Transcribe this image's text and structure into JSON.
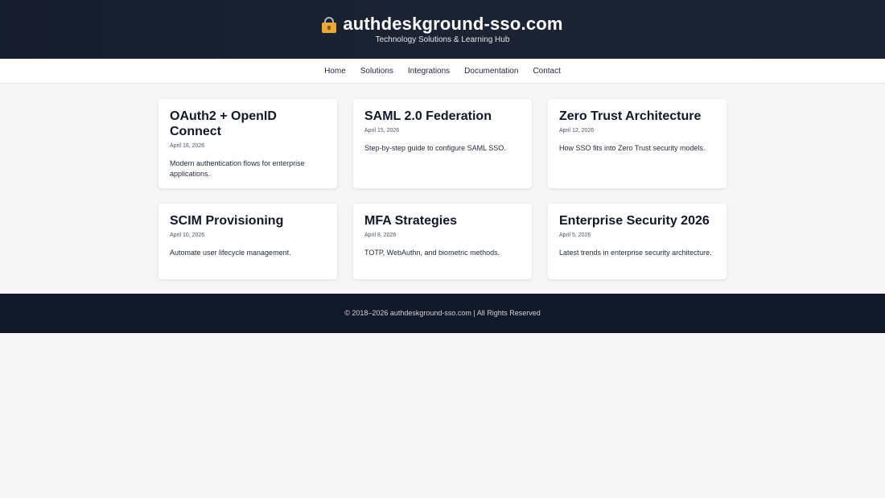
{
  "header": {
    "logo_icon": "lock-icon",
    "site_title": "authdeskground-sso.com",
    "tagline": "Technology Solutions & Learning Hub"
  },
  "nav": {
    "items": [
      {
        "label": "Home"
      },
      {
        "label": "Solutions"
      },
      {
        "label": "Integrations"
      },
      {
        "label": "Documentation"
      },
      {
        "label": "Contact"
      }
    ]
  },
  "cards": [
    {
      "title": "OAuth2 + OpenID Connect",
      "date": "April 18, 2026",
      "desc": "Modern authentication flows for enterprise applications."
    },
    {
      "title": "SAML 2.0 Federation",
      "date": "April 15, 2026",
      "desc": "Step-by-step guide to configure SAML SSO."
    },
    {
      "title": "Zero Trust Architecture",
      "date": "April 12, 2026",
      "desc": "How SSO fits into Zero Trust security models."
    },
    {
      "title": "SCIM Provisioning",
      "date": "April 10, 2026",
      "desc": "Automate user lifecycle management."
    },
    {
      "title": "MFA Strategies",
      "date": "April 8, 2026",
      "desc": "TOTP, WebAuthn, and biometric methods."
    },
    {
      "title": "Enterprise Security 2026",
      "date": "April 5, 2026",
      "desc": "Latest trends in enterprise security architecture."
    }
  ],
  "footer": {
    "text": "© 2018–2026 authdeskground-sso.com | All Rights Reserved"
  },
  "colors": {
    "header_bg": "#1a2131",
    "footer_bg": "#111827",
    "page_bg": "#f6f6f7",
    "lock_body": "#e8a93a"
  }
}
